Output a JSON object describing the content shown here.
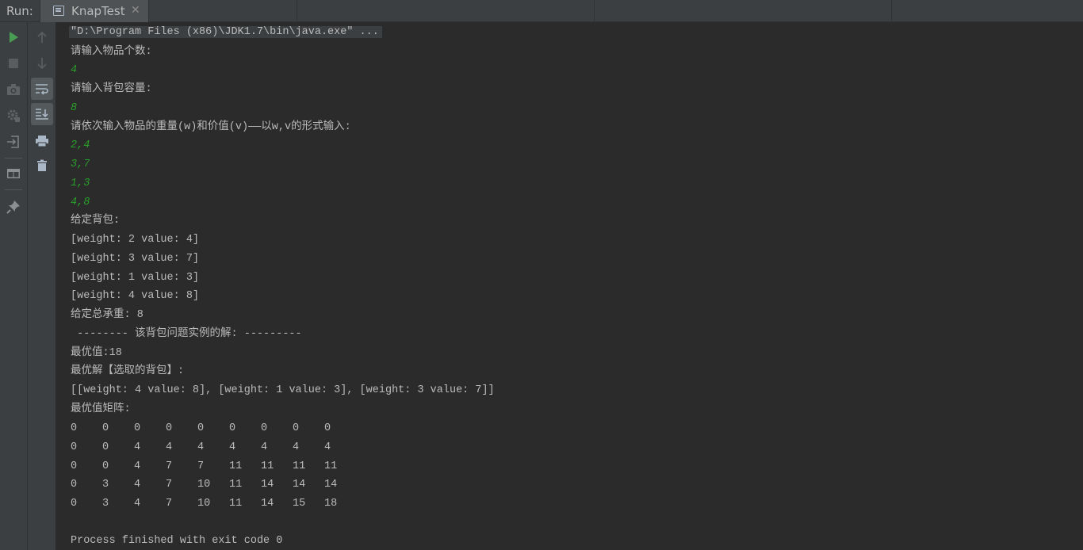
{
  "header": {
    "run_label": "Run:",
    "tab_title": "KnapTest",
    "tab_close": "✕"
  },
  "icons": {
    "run": "play-icon",
    "stop": "stop-icon",
    "up": "arrow-up-icon",
    "down": "arrow-down-icon",
    "soft_wrap": "soft-wrap-icon",
    "scroll_end": "scroll-to-end-icon",
    "camera": "camera-icon",
    "print": "print-icon",
    "settings": "gear-icon",
    "trash": "trash-icon",
    "exit": "exit-icon",
    "layout": "layout-icon",
    "pin": "pin-icon"
  },
  "colors": {
    "console_text": "#bbbbbb",
    "input_text": "#2a9e2a",
    "run_green": "#499c54",
    "background": "#2b2b2b"
  },
  "console": {
    "cmd": "\"D:\\Program Files (x86)\\JDK1.7\\bin\\java.exe\" ...",
    "prompt_count": "请输入物品个数:",
    "input_count": "4",
    "prompt_capacity": "请输入背包容量:",
    "input_capacity": "8",
    "prompt_items": "请依次输入物品的重量(w)和价值(v)——以w,v的形式输入:",
    "inputs": [
      "2,4",
      "3,7",
      "1,3",
      "4,8"
    ],
    "given_label": "给定背包:",
    "given_items": [
      "[weight: 2 value: 4]",
      "[weight: 3 value: 7]",
      "[weight: 1 value: 3]",
      "[weight: 4 value: 8]"
    ],
    "total_weight": "给定总承重: 8",
    "solution_header": " -------- 该背包问题实例的解: ---------",
    "best_value": "最优值:18",
    "best_solution_label": "最优解【选取的背包】:",
    "best_solution": "[[weight: 4 value: 8], [weight: 1 value: 3], [weight: 3 value: 7]]",
    "matrix_label": "最优值矩阵:",
    "matrix": [
      [
        "0",
        "0",
        "0",
        "0",
        "0",
        "0",
        "0",
        "0",
        "0"
      ],
      [
        "0",
        "0",
        "4",
        "4",
        "4",
        "4",
        "4",
        "4",
        "4"
      ],
      [
        "0",
        "0",
        "4",
        "7",
        "7",
        "11",
        "11",
        "11",
        "11"
      ],
      [
        "0",
        "3",
        "4",
        "7",
        "10",
        "11",
        "14",
        "14",
        "14"
      ],
      [
        "0",
        "3",
        "4",
        "7",
        "10",
        "11",
        "14",
        "15",
        "18"
      ]
    ],
    "exit_message": "Process finished with exit code 0"
  }
}
